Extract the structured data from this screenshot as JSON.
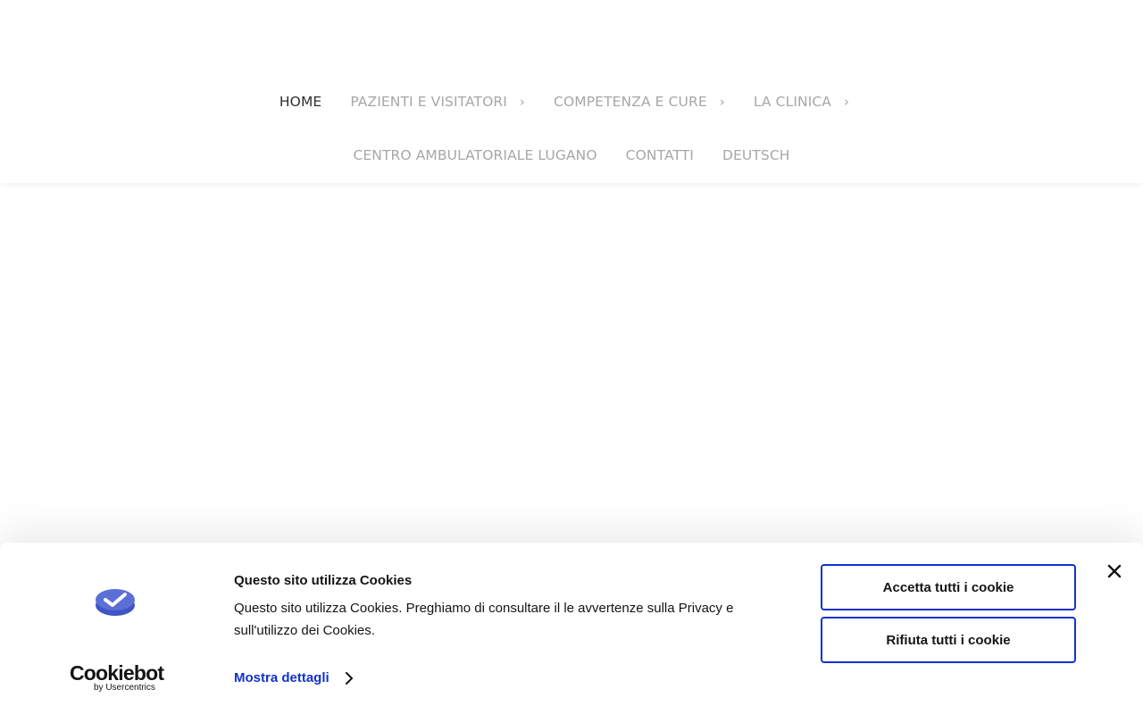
{
  "nav": {
    "row1": [
      {
        "label": "HOME",
        "active": true,
        "has_submenu": false
      },
      {
        "label": "PAZIENTI E VISITATORI",
        "active": false,
        "has_submenu": true
      },
      {
        "label": "COMPETENZA E CURE",
        "active": false,
        "has_submenu": true
      },
      {
        "label": "LA CLINICA",
        "active": false,
        "has_submenu": true
      }
    ],
    "row2": [
      {
        "label": "CENTRO AMBULATORIALE LUGANO"
      },
      {
        "label": "CONTATTI"
      },
      {
        "label": "DEUTSCH"
      }
    ],
    "submenu_glyph": "›"
  },
  "cookie_banner": {
    "logo": {
      "wordmark": "Cookiebot",
      "byline": "by Usercentrics"
    },
    "title": "Questo sito utilizza Cookies",
    "text": "Questo sito utilizza Cookies. Preghiamo di consultare il le avvertenze sulla Privacy e sull'utilizzo dei Cookies.",
    "details_link": "Mostra dettagli",
    "accept_button": "Accetta tutti i cookie",
    "reject_button": "Rifiuta tutti i cookie",
    "close_icon": "close-icon"
  },
  "colors": {
    "nav_active": "#2e2e2e",
    "nav_inactive": "#a7a7a7",
    "accent_blue": "#1032cf",
    "cookiebot_logo": "#5b6fd6"
  }
}
